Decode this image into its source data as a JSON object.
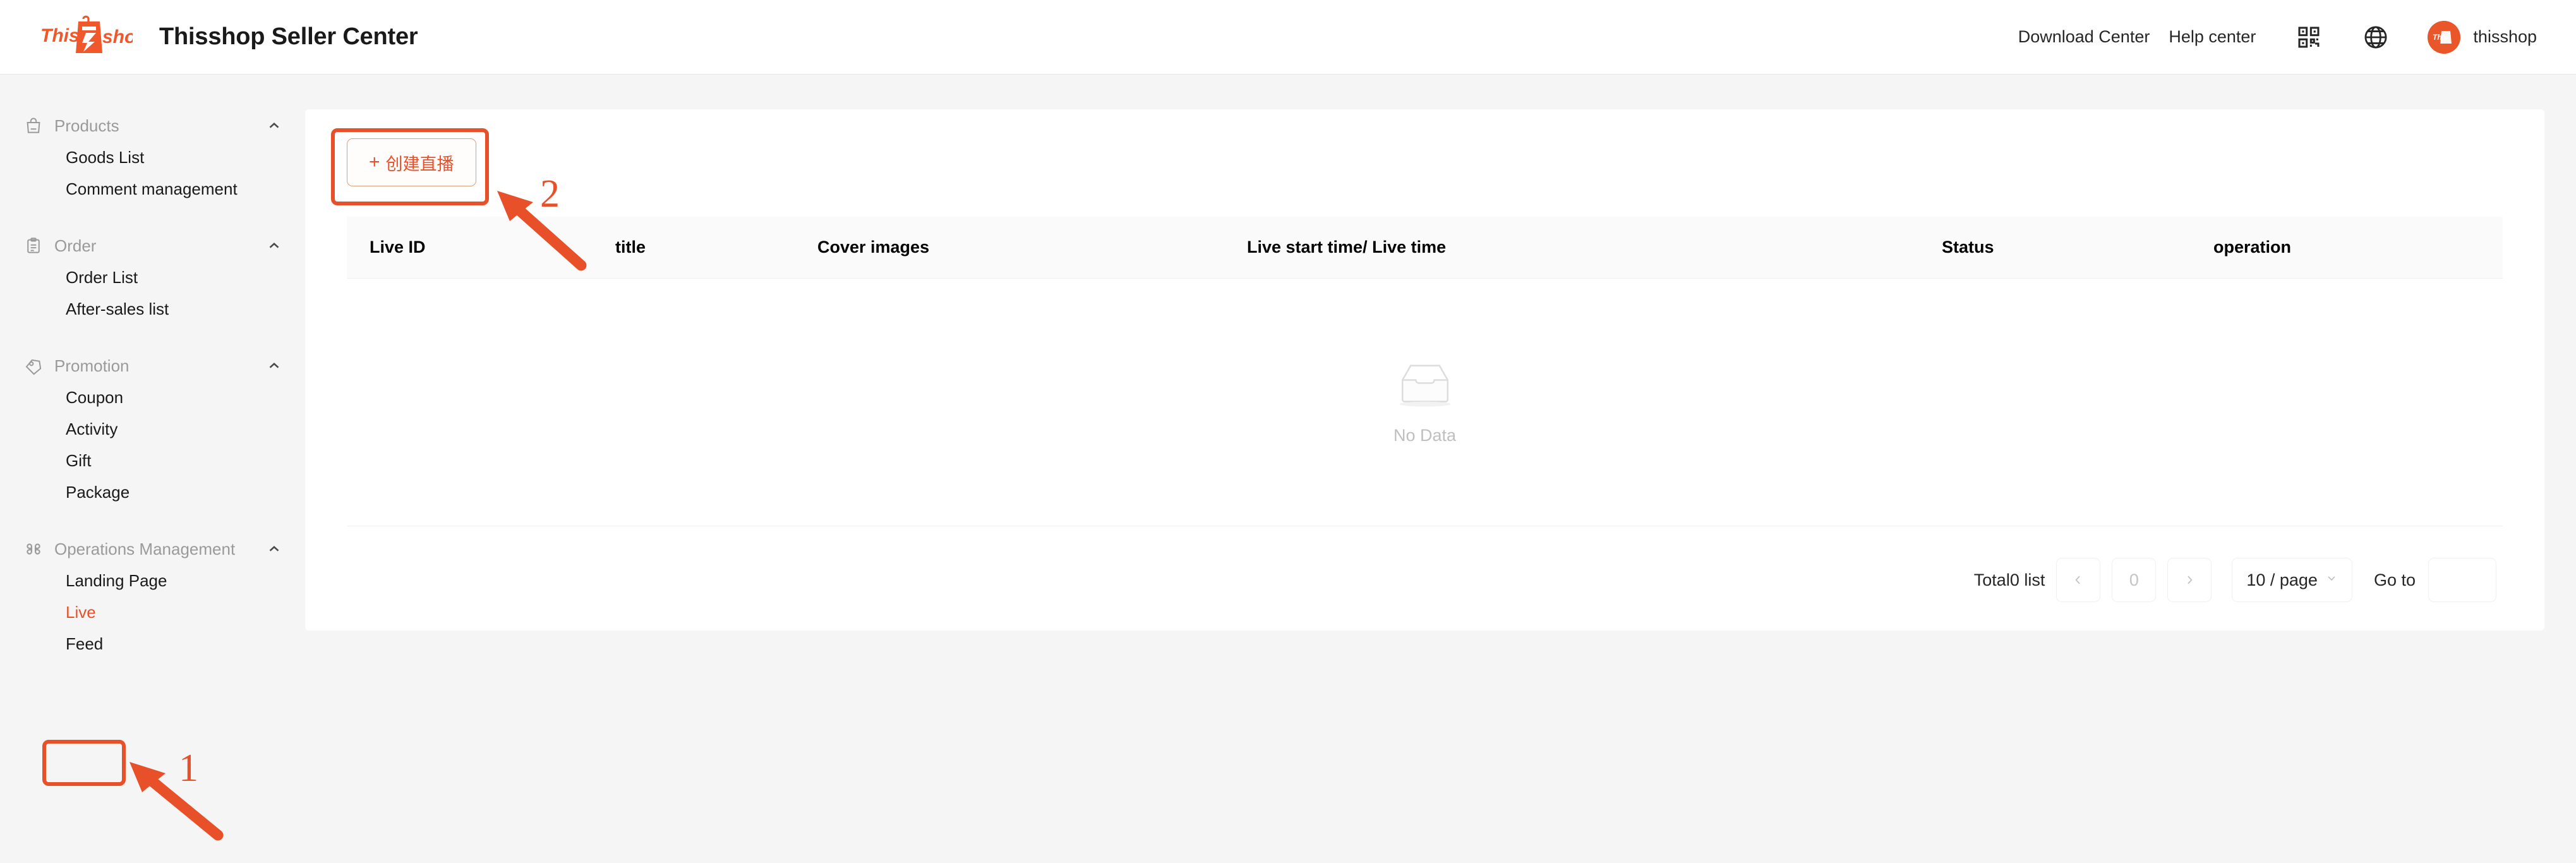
{
  "header": {
    "logo_text_this": "This",
    "logo_text_shop": "shop",
    "app_title": "Thisshop Seller Center",
    "download_center": "Download Center",
    "help_center": "Help center",
    "qr_icon": "qr-code-icon",
    "globe_icon": "globe-icon",
    "avatar_icon": "user-avatar",
    "user_name": "thisshop"
  },
  "sidebar": {
    "groups": [
      {
        "label": "Products",
        "icon": "shopping-bag-icon",
        "caret": "chevron-up-icon",
        "items": [
          {
            "label": "Goods List",
            "active": false
          },
          {
            "label": "Comment management",
            "active": false
          }
        ]
      },
      {
        "label": "Order",
        "icon": "clipboard-icon",
        "caret": "chevron-up-icon",
        "items": [
          {
            "label": "Order List",
            "active": false
          },
          {
            "label": "After-sales list",
            "active": false
          }
        ]
      },
      {
        "label": "Promotion",
        "icon": "price-tag-icon",
        "caret": "chevron-up-icon",
        "items": [
          {
            "label": "Coupon",
            "active": false
          },
          {
            "label": "Activity",
            "active": false
          },
          {
            "label": "Gift",
            "active": false
          },
          {
            "label": "Package",
            "active": false
          }
        ]
      },
      {
        "label": "Operations Management",
        "icon": "command-grid-icon",
        "caret": "chevron-up-icon",
        "items": [
          {
            "label": "Landing Page",
            "active": false
          },
          {
            "label": "Live",
            "active": true
          },
          {
            "label": "Feed",
            "active": false
          }
        ]
      }
    ]
  },
  "main": {
    "create_button": {
      "plus": "+",
      "label": "创建直播"
    },
    "table": {
      "columns": [
        "Live ID",
        "title",
        "Cover images",
        "Live start time/ Live time",
        "Status",
        "operation"
      ],
      "rows": [],
      "empty_text": "No Data",
      "empty_icon": "empty-box-icon"
    },
    "pagination": {
      "total_label": "Total0 list",
      "prev_icon": "chevron-left-icon",
      "current_page": "0",
      "next_icon": "chevron-right-icon",
      "page_size": "10 / page",
      "page_size_caret": "chevron-down-icon",
      "goto_label": "Go to",
      "goto_value": ""
    }
  },
  "annotations": {
    "step1": "1",
    "step2": "2",
    "accent_color": "#e8502a"
  }
}
